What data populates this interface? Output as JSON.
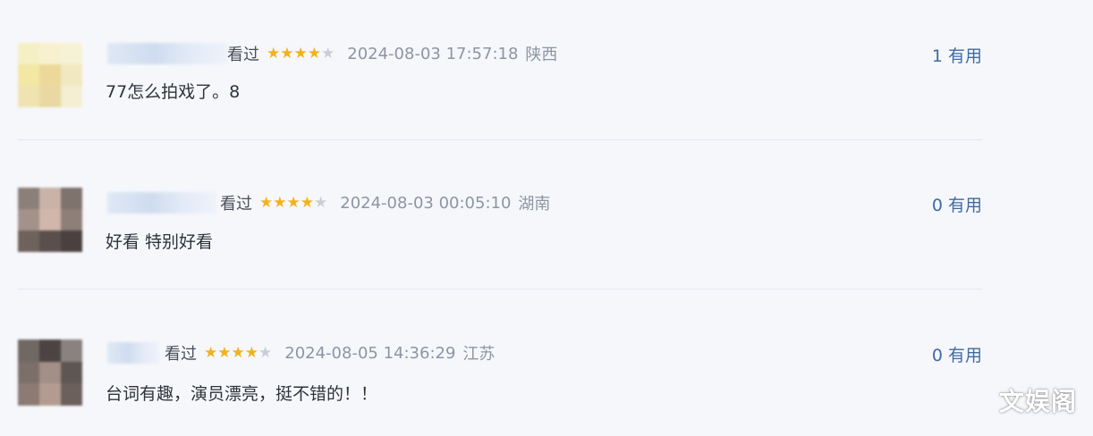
{
  "comments": [
    {
      "status": "看过",
      "rating": 4,
      "max_rating": 5,
      "time": "2024-08-03 17:57:18",
      "location": "陕西",
      "text": "77怎么拍戏了。8",
      "useful_count": "1",
      "useful_label": "有用",
      "avatar_colors": [
        "#f4f0c4",
        "#f7f1cf",
        "#f5f2d6",
        "#f2e7a3",
        "#ecd99a",
        "#f1e8c1",
        "#efe3b2",
        "#e9d8a1",
        "#f4eed2"
      ]
    },
    {
      "status": "看过",
      "rating": 4,
      "max_rating": 5,
      "time": "2024-08-03 00:05:10",
      "location": "湖南",
      "text": "好看 特别好看",
      "useful_count": "0",
      "useful_label": "有用",
      "avatar_colors": [
        "#8b7f79",
        "#c9b3a8",
        "#7f736d",
        "#a3928a",
        "#d1b7ab",
        "#8e7f78",
        "#6f625d",
        "#5a4f4c",
        "#4a403f"
      ]
    },
    {
      "status": "看过",
      "rating": 4,
      "max_rating": 5,
      "time": "2024-08-05 14:36:29",
      "location": "江苏",
      "text": "台词有趣，演员漂亮，挺不错的！！",
      "useful_count": "0",
      "useful_label": "有用",
      "avatar_colors": [
        "#6f6863",
        "#4a4442",
        "#8a827e",
        "#7c6f6a",
        "#a38f87",
        "#5e5652",
        "#8c7a73",
        "#b39b91",
        "#6b605c"
      ]
    }
  ],
  "watermark": "文娱阁"
}
